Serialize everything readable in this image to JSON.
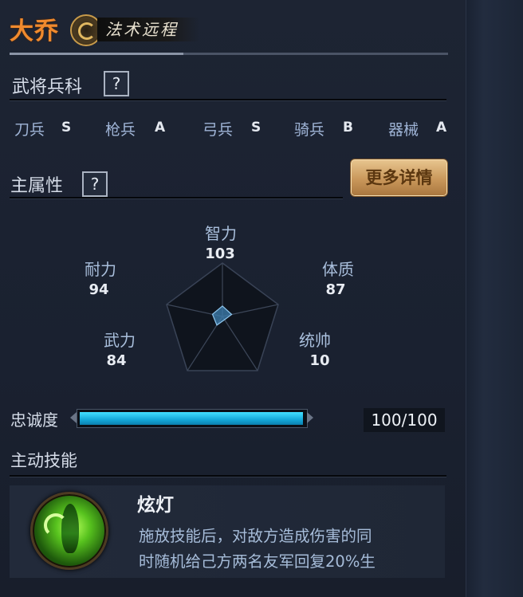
{
  "hero": {
    "name": "大乔",
    "class_label": "法术远程",
    "class_icon": "class-emblem-icon"
  },
  "troop_section": {
    "title": "武将兵科",
    "help": "?",
    "troops": [
      {
        "label": "刀兵",
        "grade": "S"
      },
      {
        "label": "枪兵",
        "grade": "A"
      },
      {
        "label": "弓兵",
        "grade": "S"
      },
      {
        "label": "骑兵",
        "grade": "B"
      },
      {
        "label": "器械",
        "grade": "A"
      }
    ]
  },
  "attributes": {
    "title": "主属性",
    "help": "?",
    "more_button": "更多详情",
    "stats": [
      {
        "label": "智力",
        "value": "103"
      },
      {
        "label": "体质",
        "value": "87"
      },
      {
        "label": "统帅",
        "value": "10"
      },
      {
        "label": "武力",
        "value": "84"
      },
      {
        "label": "耐力",
        "value": "94"
      }
    ]
  },
  "loyalty": {
    "label": "忠诚度",
    "value_text": "100/100",
    "fraction": 1.0
  },
  "active_skill": {
    "section_title": "主动技能",
    "name": "炫灯",
    "description": "施放技能后，对敌方造成伤害的同\n时随机给己方两名友军回复20%生",
    "icon": "skill-lantern-icon"
  },
  "colors": {
    "name_orange": "#f08a2e",
    "loyalty_cyan": "#13a8d8",
    "button_gold": "#c9975a",
    "radar_fill": "#3e7fb0"
  }
}
